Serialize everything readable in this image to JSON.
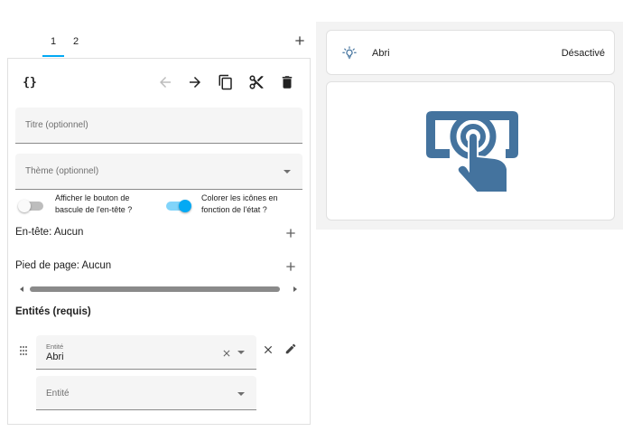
{
  "tabs": [
    {
      "label": "1"
    },
    {
      "label": "2"
    }
  ],
  "editor": {
    "code_icon": "{}",
    "title_placeholder": "Titre (optionnel)",
    "theme_placeholder": "Thème (optionnel)",
    "toggle_header": {
      "label": "Afficher le bouton de bascule de l'en-tête ?",
      "checked": false
    },
    "color_icons": {
      "label": "Colorer les icônes en fonction de l'état ?",
      "checked": true
    },
    "header_row": "En-tête: Aucun",
    "footer_row": "Pied de page: Aucun",
    "entities_title": "Entités (requis)",
    "entity_label": "Entité",
    "entity_value": "Abri",
    "entity_empty_placeholder": "Entité"
  },
  "preview": {
    "entity_name": "Abri",
    "entity_state": "Désactivé",
    "entity_icon": "lightbulb-icon",
    "button_icon": "touch-app-icon",
    "accent_color": "#44739e"
  },
  "colors": {
    "accent": "#03a9f4",
    "preview_icon": "#44739e"
  }
}
